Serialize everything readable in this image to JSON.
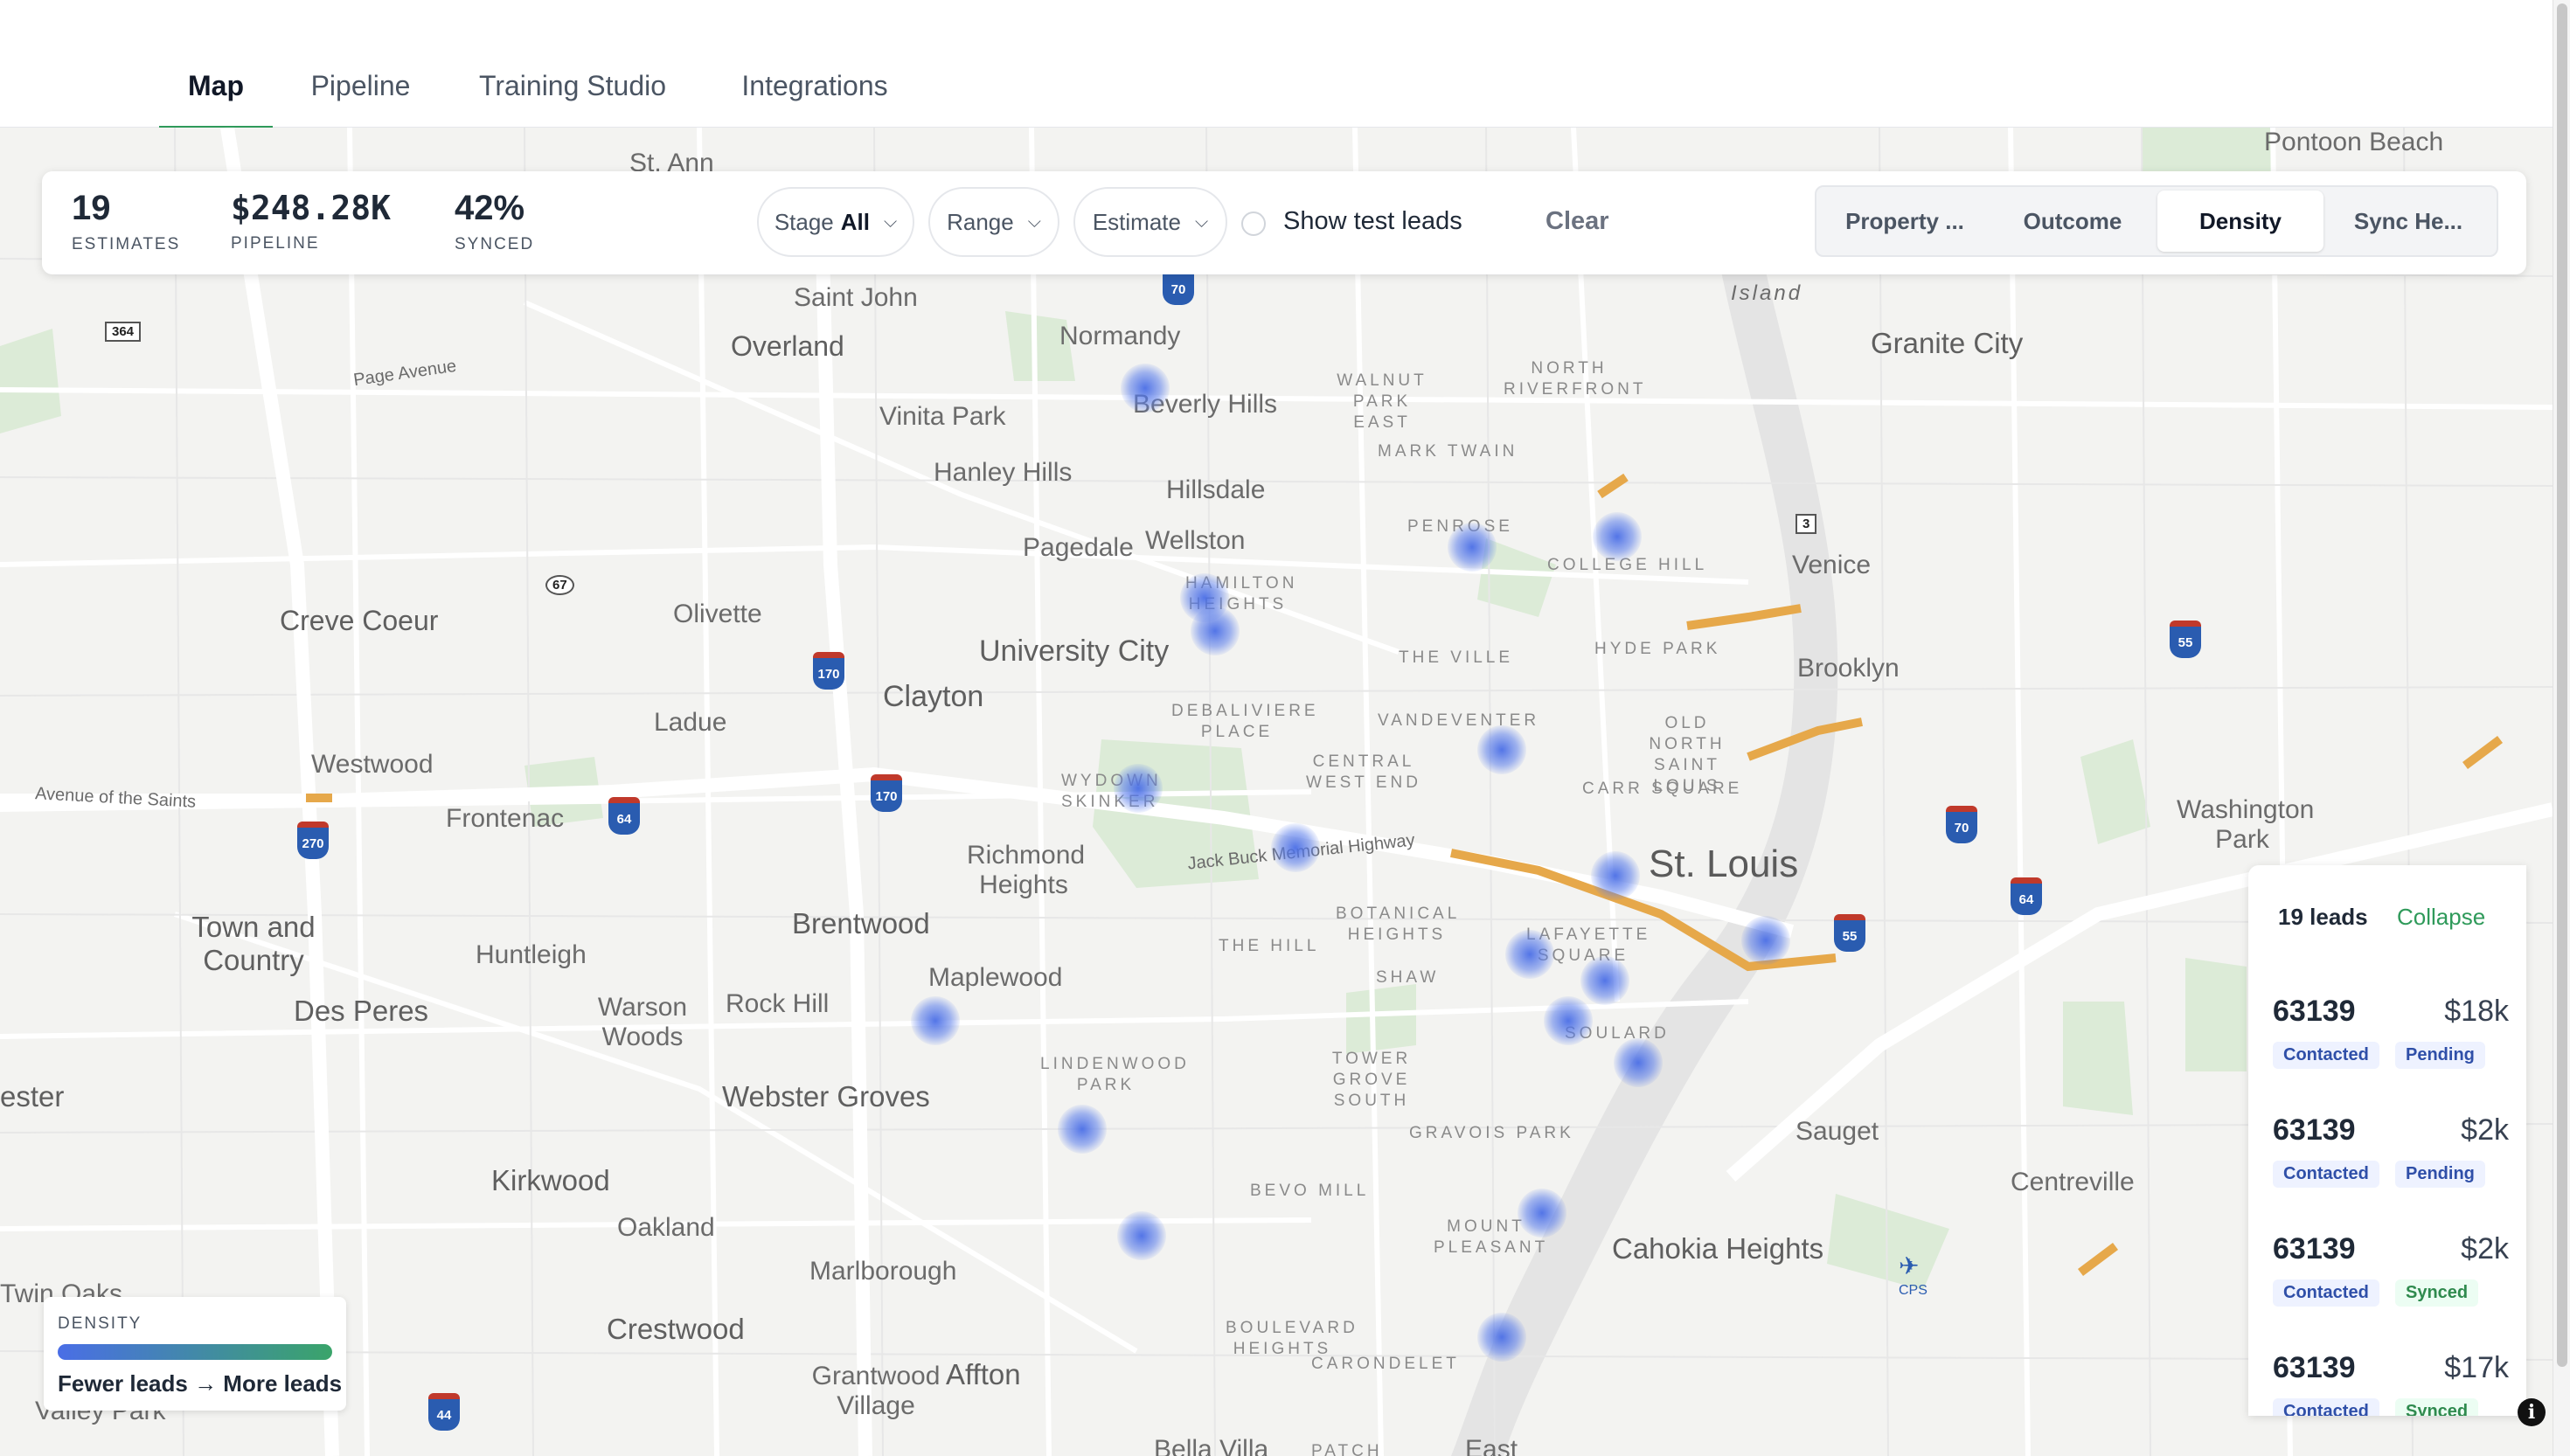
{
  "nav": {
    "tabs": [
      {
        "label": "Map",
        "active": true
      },
      {
        "label": "Pipeline",
        "active": false
      },
      {
        "label": "Training Studio",
        "active": false
      },
      {
        "label": "Integrations",
        "active": false
      }
    ]
  },
  "stats": [
    {
      "value": "19",
      "label": "ESTIMATES"
    },
    {
      "value": "$248.28K",
      "label": "PIPELINE"
    },
    {
      "value": "42%",
      "label": "SYNCED"
    }
  ],
  "filters": {
    "stage_label": "Stage",
    "stage_value": "All",
    "range_label": "Range",
    "estimate_label": "Estimate",
    "show_test_leads": "Show test leads",
    "show_test_leads_checked": false,
    "clear": "Clear"
  },
  "views": {
    "items": [
      "Property ...",
      "Outcome",
      "Density",
      "Sync He..."
    ],
    "active": "Density"
  },
  "leads_panel": {
    "count_label": "19 leads",
    "collapse": "Collapse",
    "rows": [
      {
        "zip": "63139",
        "amount": "$18k",
        "status": "Contacted",
        "sync": "Pending"
      },
      {
        "zip": "63139",
        "amount": "$2k",
        "status": "Contacted",
        "sync": "Pending"
      },
      {
        "zip": "63139",
        "amount": "$2k",
        "status": "Contacted",
        "sync": "Synced"
      },
      {
        "zip": "63139",
        "amount": "$17k",
        "status": "Contacted",
        "sync": "Synced"
      }
    ]
  },
  "legend": {
    "title": "DENSITY",
    "description": "Fewer leads → More leads"
  },
  "map": {
    "places": [
      "St. Ann",
      "Saint John",
      "Overland",
      "Normandy",
      "Beverly Hills",
      "Vinita Park",
      "Hanley Hills",
      "Hillsdale",
      "Pagedale",
      "Wellston",
      "Creve Coeur",
      "Olivette",
      "University City",
      "Clayton",
      "Ladue",
      "Westwood",
      "Frontenac",
      "Richmond Heights",
      "Brentwood",
      "Maplewood",
      "Town and Country",
      "Huntleigh",
      "Des Peres",
      "Warson Woods",
      "Rock Hill",
      "Webster Groves",
      "Kirkwood",
      "Oakland",
      "Marlborough",
      "Crestwood",
      "Grantwood Village",
      "Affton",
      "St. Louis",
      "Granite City",
      "Venice",
      "Brooklyn",
      "Washington Park",
      "Sauget",
      "Centreville",
      "Cahokia Heights",
      "Pontoon Beach",
      "ester",
      "Twin Oaks",
      "Valley Park",
      "Bella Villa",
      "East"
    ],
    "neighborhoods": [
      "WALNUT PARK EAST",
      "NORTH RIVERFRONT",
      "MARK TWAIN",
      "PENROSE",
      "COLLEGE HILL",
      "HAMILTON HEIGHTS",
      "THE VILLE",
      "HYDE PARK",
      "DEBALIVIERE PLACE",
      "VANDEVENTER",
      "OLD NORTH SAINT LOUIS",
      "WYDOWN SKINKER",
      "CENTRAL WEST END",
      "CARR SQUARE",
      "BOTANICAL HEIGHTS",
      "THE HILL",
      "LAFAYETTE SQUARE",
      "SHAW",
      "SOULARD",
      "LINDENWOOD PARK",
      "TOWER GROVE SOUTH",
      "GRAVOIS PARK",
      "BEVO MILL",
      "MOUNT PLEASANT",
      "BOULEVARD HEIGHTS",
      "CARONDELET",
      "PATCH",
      "Island"
    ],
    "roads": [
      "Page Avenue",
      "Avenue of the Saints",
      "Jack Buck Memorial Highway"
    ],
    "shields": [
      "364",
      "67",
      "170",
      "170",
      "64",
      "270",
      "70",
      "3",
      "55",
      "70",
      "64",
      "55",
      "44"
    ],
    "airport": "CPS"
  }
}
